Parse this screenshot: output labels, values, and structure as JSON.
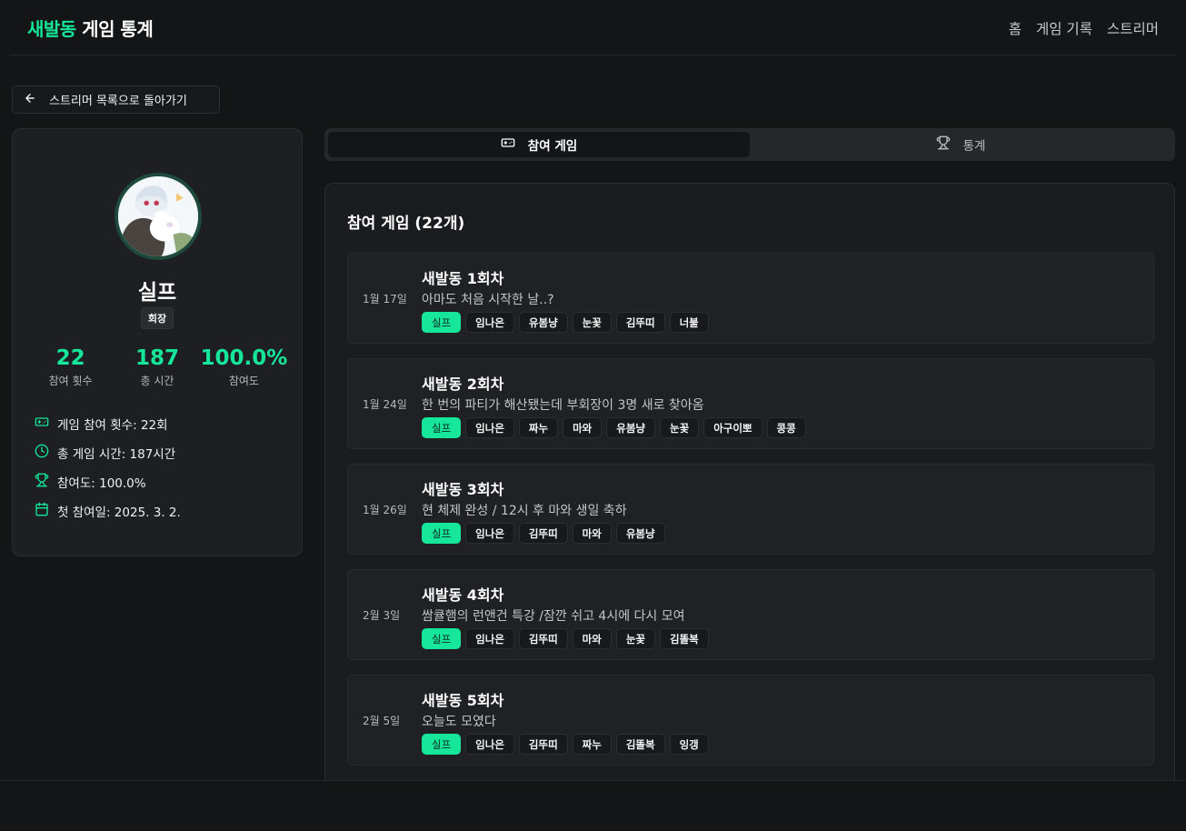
{
  "header": {
    "brand_accent": "새발동",
    "brand_rest": "게임 통계",
    "nav": [
      "홈",
      "게임 기록",
      "스트리머"
    ]
  },
  "back_button": {
    "label": "스트리머 목록으로 돌아가기",
    "icon": "arrow-left-icon"
  },
  "profile": {
    "name": "실프",
    "role": "회장",
    "stats": [
      {
        "value": "22",
        "label": "참여 횟수"
      },
      {
        "value": "187",
        "label": "총 시간"
      },
      {
        "value": "100.0%",
        "label": "참여도"
      }
    ],
    "info": [
      {
        "icon": "gamepad-icon",
        "text": "게임 참여 횟수: 22회"
      },
      {
        "icon": "clock-icon",
        "text": "총 게임 시간: 187시간"
      },
      {
        "icon": "trophy-icon",
        "text": "참여도: 100.0%"
      },
      {
        "icon": "calendar-icon",
        "text": "첫 참여일: 2025. 3. 2."
      }
    ]
  },
  "tabs": [
    {
      "label": "참여 게임",
      "icon": "gamepad-icon",
      "active": true
    },
    {
      "label": "통계",
      "icon": "trophy-icon",
      "active": false
    }
  ],
  "games_panel": {
    "title": "참여 게임 (22개)",
    "games": [
      {
        "date": "1월 17일",
        "title": "새발동 1회차",
        "desc": "아마도 처음 시작한 날..?",
        "tags": [
          "실프",
          "임나은",
          "유봄냥",
          "눈꽃",
          "김뚜띠",
          "너불"
        ]
      },
      {
        "date": "1월 24일",
        "title": "새발동 2회차",
        "desc": "한 번의 파티가 해산됐는데 부회장이 3명 새로 찾아옴",
        "tags": [
          "실프",
          "임나은",
          "짜누",
          "마와",
          "유봄냥",
          "눈꽃",
          "아구이뽀",
          "콩콩"
        ]
      },
      {
        "date": "1월 26일",
        "title": "새발동 3회차",
        "desc": "현 체제 완성 / 12시 후 마와 생일 축하",
        "tags": [
          "실프",
          "임나은",
          "김뚜띠",
          "마와",
          "유봄냥"
        ]
      },
      {
        "date": "2월 3일",
        "title": "새발동 4회차",
        "desc": "쌈큘햄의 런앤건 특강 /잠깐 쉬고 4시에 다시 모여",
        "tags": [
          "실프",
          "임나은",
          "김뚜띠",
          "마와",
          "눈꽃",
          "김똘복"
        ]
      },
      {
        "date": "2월 5일",
        "title": "새발동 5회차",
        "desc": "오늘도 모였다",
        "tags": [
          "실프",
          "임나은",
          "김뚜띠",
          "짜누",
          "김똘복",
          "잉갱"
        ]
      }
    ]
  },
  "colors": {
    "accent": "#16e69a",
    "background": "#141517",
    "card": "#1e1f22"
  }
}
